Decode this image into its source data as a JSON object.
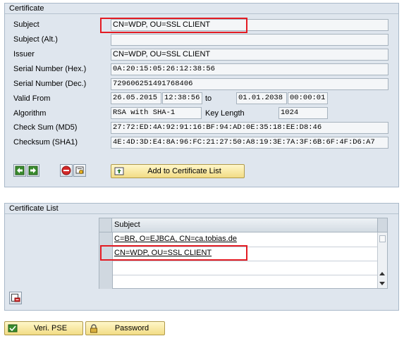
{
  "certificate": {
    "title": "Certificate",
    "fields": {
      "subject": {
        "label": "Subject",
        "value": "CN=WDP, OU=SSL CLIENT"
      },
      "subject_alt": {
        "label": "Subject (Alt.)",
        "value": ""
      },
      "issuer": {
        "label": "Issuer",
        "value": "CN=WDP, OU=SSL CLIENT"
      },
      "serial_hex": {
        "label": "Serial Number (Hex.)",
        "value": "0A:20:15:05:26:12:38:56"
      },
      "serial_dec": {
        "label": "Serial Number (Dec.)",
        "value": "729606251491768406"
      },
      "valid_from": {
        "label": "Valid From",
        "date": "26.05.2015",
        "time": "12:38:56",
        "to_label": "to",
        "to_date": "01.01.2038",
        "to_time": "00:00:01"
      },
      "algorithm": {
        "label": "Algorithm",
        "value": "RSA with SHA-1",
        "key_length_label": "Key Length",
        "key_length": "1024"
      },
      "checksum_md5": {
        "label": "Check Sum (MD5)",
        "value": "27:72:ED:4A:92:91:16:BF:94:AD:0E:35:18:EE:D8:46"
      },
      "checksum_sha1": {
        "label": "Checksum (SHA1)",
        "value": "4E:4D:3D:E4:8A:96:FC:21:27:50:A8:19:3E:7A:3F:6B:6F:4F:D6:A7"
      }
    },
    "add_button_label": "Add to Certificate List"
  },
  "certificate_list": {
    "title": "Certificate List",
    "column_header": "Subject",
    "rows": [
      "C=BR, O=EJBCA, CN=ca.tobias.de",
      "CN=WDP, OU=SSL CLIENT",
      "",
      ""
    ]
  },
  "bottom": {
    "veri_pse_label": "Veri. PSE",
    "password_label": "Password"
  },
  "colors": {
    "highlight": "#e31b23",
    "panel": "#dfe6ee",
    "button": "#f2dc85"
  }
}
